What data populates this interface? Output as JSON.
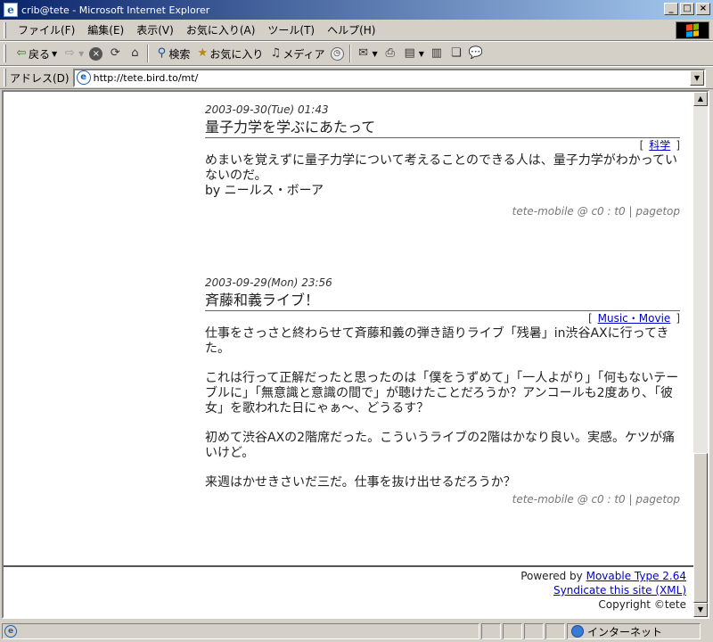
{
  "window": {
    "title": "crib@tete - Microsoft Internet Explorer",
    "icon": "ie-page-icon"
  },
  "menubar": {
    "items": [
      "ファイル(F)",
      "編集(E)",
      "表示(V)",
      "お気に入り(A)",
      "ツール(T)",
      "ヘルプ(H)"
    ]
  },
  "toolbar": {
    "back_label": "戻る",
    "search_label": "検索",
    "favorites_label": "お気に入り",
    "media_label": "メディア"
  },
  "addressbar": {
    "label": "アドレス(D)",
    "url": "http://tete.bird.to/mt/"
  },
  "entries": [
    {
      "date": "2003-09-30(Tue) 01:43",
      "title": "量子力学を学ぶにあたって",
      "category": "科学",
      "paragraphs": [
        "めまいを覚えずに量子力学について考えることのできる人は、量子力学がわかっていないのだ。",
        "by ニールス・ボーア"
      ],
      "footer": "tete-mobile @ c0 : t0 | pagetop"
    },
    {
      "date": "2003-09-29(Mon) 23:56",
      "title": "斉藤和義ライブ！",
      "category": "Music・Movie",
      "paragraphs": [
        "仕事をさっさと終わらせて斉藤和義の弾き語りライブ「残暑」in渋谷AXに行ってきた。",
        "これは行って正解だったと思ったのは「僕をうずめて」「一人よがり」「何もないテーブルに」「無意識と意識の間で」が聴けたことだろうか？アンコールも2度あり、「彼女」を歌われた日にゃぁ～、どうるす？",
        "初めて渋谷AXの2階席だった。こういうライブの2階はかなり良い。実感。ケツが痛いけど。",
        "来週はかせきさいだ三だ。仕事を抜け出せるだろうか？"
      ],
      "footer": "tete-mobile @ c0 : t0 | pagetop"
    }
  ],
  "page_footer": {
    "powered_prefix": "Powered by ",
    "powered_link": "Movable Type 2.64",
    "syndicate_link": "Syndicate this site (XML)",
    "copyright": "Copyright ©tete"
  },
  "statusbar": {
    "text": "",
    "zone": "インターネット"
  }
}
